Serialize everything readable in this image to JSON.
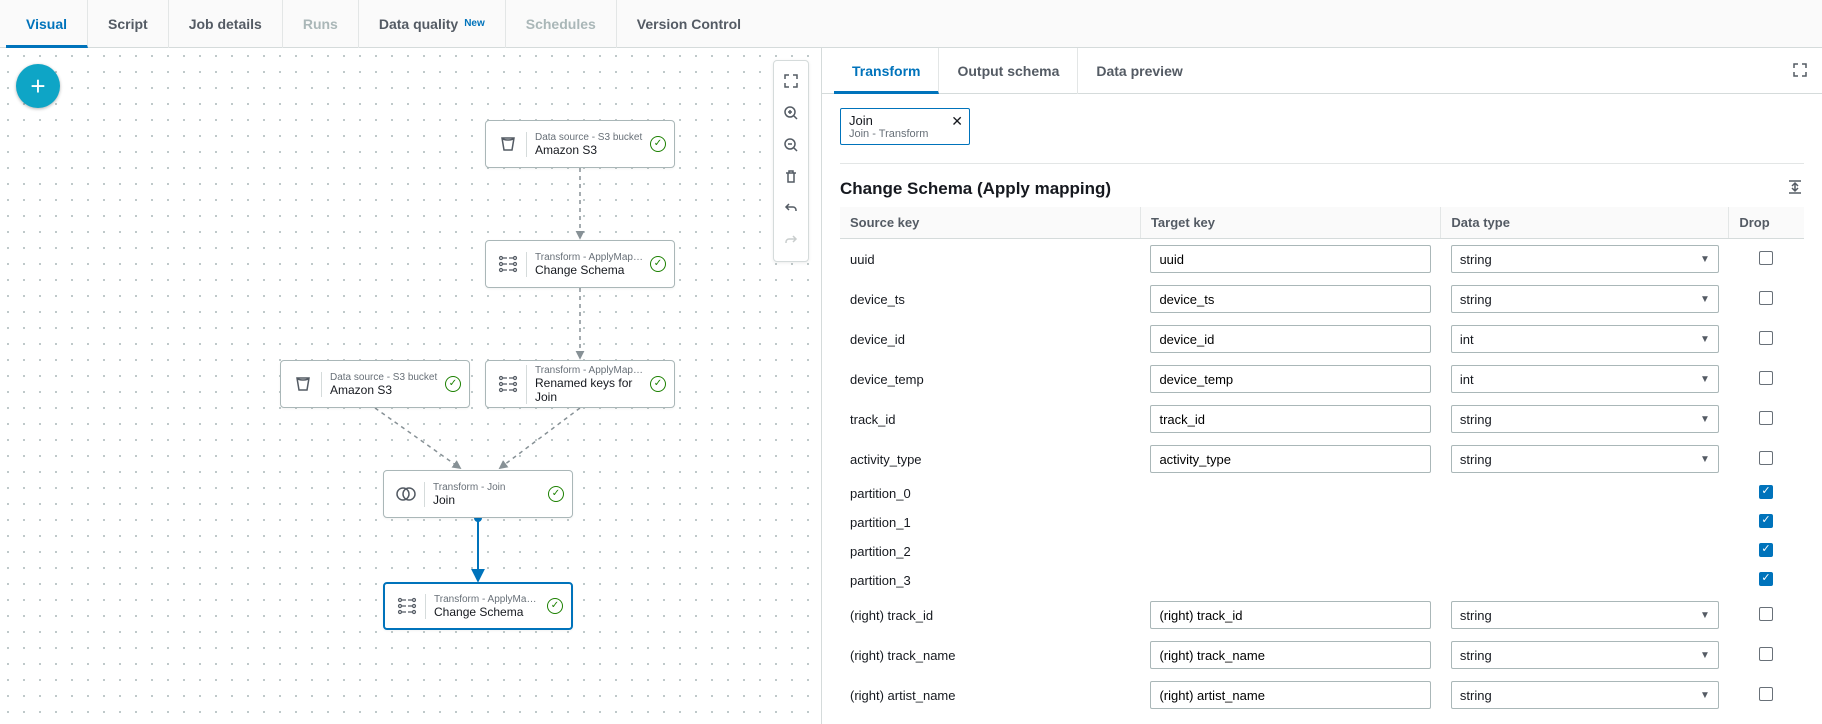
{
  "topTabs": {
    "visual": "Visual",
    "script": "Script",
    "jobDetails": "Job details",
    "runs": "Runs",
    "dataQuality": "Data quality",
    "dataQualityNew": "New",
    "schedules": "Schedules",
    "versionControl": "Version Control"
  },
  "panelTabs": {
    "transform": "Transform",
    "outputSchema": "Output schema",
    "dataPreview": "Data preview"
  },
  "chip": {
    "title": "Join",
    "subtitle": "Join - Transform"
  },
  "sectionTitle": "Change Schema (Apply mapping)",
  "headers": {
    "source": "Source key",
    "target": "Target key",
    "type": "Data type",
    "drop": "Drop"
  },
  "nodes": {
    "s3_top": {
      "type": "Data source - S3 bucket",
      "name": "Amazon S3"
    },
    "change1": {
      "type": "Transform - ApplyMappi...",
      "name": "Change Schema"
    },
    "s3_left": {
      "type": "Data source - S3 bucket",
      "name": "Amazon S3"
    },
    "renamed": {
      "type": "Transform - ApplyMappi...",
      "name": "Renamed keys for Join"
    },
    "join": {
      "type": "Transform - Join",
      "name": "Join"
    },
    "change2": {
      "type": "Transform - ApplyMappi...",
      "name": "Change Schema"
    }
  },
  "rows": [
    {
      "source": "uuid",
      "target": "uuid",
      "type": "string",
      "drop": false
    },
    {
      "source": "device_ts",
      "target": "device_ts",
      "type": "string",
      "drop": false
    },
    {
      "source": "device_id",
      "target": "device_id",
      "type": "int",
      "drop": false
    },
    {
      "source": "device_temp",
      "target": "device_temp",
      "type": "int",
      "drop": false
    },
    {
      "source": "track_id",
      "target": "track_id",
      "type": "string",
      "drop": false
    },
    {
      "source": "activity_type",
      "target": "activity_type",
      "type": "string",
      "drop": false
    },
    {
      "source": "partition_0",
      "target": "",
      "type": "",
      "drop": true
    },
    {
      "source": "partition_1",
      "target": "",
      "type": "",
      "drop": true
    },
    {
      "source": "partition_2",
      "target": "",
      "type": "",
      "drop": true
    },
    {
      "source": "partition_3",
      "target": "",
      "type": "",
      "drop": true
    },
    {
      "source": "(right) track_id",
      "target": "(right) track_id",
      "type": "string",
      "drop": false
    },
    {
      "source": "(right) track_name",
      "target": "(right) track_name",
      "type": "string",
      "drop": false
    },
    {
      "source": "(right) artist_name",
      "target": "(right) artist_name",
      "type": "string",
      "drop": false
    }
  ]
}
